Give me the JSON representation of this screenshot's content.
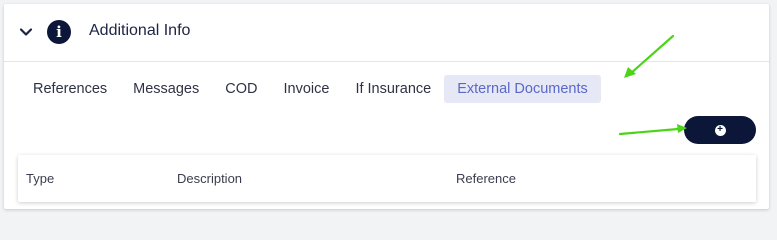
{
  "section": {
    "title": "Additional Info",
    "collapse_icon": "chevron-down-icon",
    "info_icon": "info-icon",
    "info_glyph": "i"
  },
  "tabs": [
    {
      "label": "References",
      "active": false
    },
    {
      "label": "Messages",
      "active": false
    },
    {
      "label": "COD",
      "active": false
    },
    {
      "label": "Invoice",
      "active": false
    },
    {
      "label": "If Insurance",
      "active": false
    },
    {
      "label": "External Documents",
      "active": true
    }
  ],
  "add_button": {
    "icon": "plus-circle-icon",
    "glyph": "+"
  },
  "table": {
    "columns": [
      "Type",
      "Description",
      "Reference"
    ]
  },
  "colors": {
    "dark_navy": "#0c1638",
    "active_tab_bg": "#e6e8f5",
    "active_tab_text": "#5a68c7",
    "annotation_arrow": "#4cd417"
  }
}
